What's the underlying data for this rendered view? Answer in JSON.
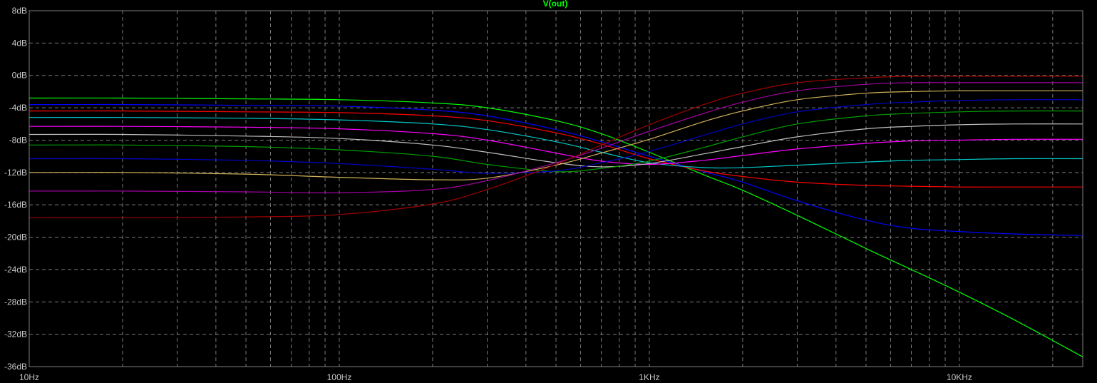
{
  "chart_data": {
    "type": "line",
    "title": "V(out)",
    "xscale": "log",
    "xlim": [
      10,
      25000
    ],
    "ylim": [
      -36,
      8
    ],
    "grid": true,
    "x_ticks": [
      {
        "value": 10,
        "label": "10Hz"
      },
      {
        "value": 100,
        "label": "100Hz"
      },
      {
        "value": 1000,
        "label": "1KHz"
      },
      {
        "value": 10000,
        "label": "10KHz"
      }
    ],
    "y_ticks": [
      {
        "value": 8,
        "label": "8dB"
      },
      {
        "value": 4,
        "label": "4dB"
      },
      {
        "value": 0,
        "label": "0dB"
      },
      {
        "value": -4,
        "label": "-4dB"
      },
      {
        "value": -8,
        "label": "-8dB"
      },
      {
        "value": -12,
        "label": "-12dB"
      },
      {
        "value": -16,
        "label": "-16dB"
      },
      {
        "value": -20,
        "label": "-20dB"
      },
      {
        "value": -24,
        "label": "-24dB"
      },
      {
        "value": -28,
        "label": "-28dB"
      },
      {
        "value": -32,
        "label": "-32dB"
      },
      {
        "value": -36,
        "label": "-36dB"
      }
    ],
    "x": [
      10,
      20,
      50,
      100,
      200,
      300,
      500,
      700,
      1000,
      1500,
      2000,
      3000,
      5000,
      7000,
      10000,
      15000,
      25000
    ],
    "series": [
      {
        "color": "#00ff00",
        "values": [
          -2.8,
          -2.8,
          -2.9,
          -3.0,
          -3.4,
          -4.0,
          -5.6,
          -7.2,
          -9.5,
          -12.3,
          -14.2,
          -17.3,
          -21.4,
          -24.0,
          -26.8,
          -30.2,
          -34.8
        ]
      },
      {
        "color": "#0000ff",
        "values": [
          -3.6,
          -3.6,
          -3.7,
          -3.8,
          -4.3,
          -5.0,
          -6.7,
          -8.2,
          -10.0,
          -11.9,
          -13.2,
          -15.5,
          -17.9,
          -18.9,
          -19.3,
          -19.6,
          -19.8
        ]
      },
      {
        "color": "#ff0000",
        "values": [
          -4.4,
          -4.4,
          -4.5,
          -4.6,
          -5.0,
          -5.6,
          -7.1,
          -8.5,
          -10.3,
          -11.8,
          -12.5,
          -13.2,
          -13.6,
          -13.7,
          -13.8,
          -13.8,
          -13.8
        ]
      },
      {
        "color": "#00c8c8",
        "values": [
          -5.2,
          -5.2,
          -5.3,
          -5.5,
          -6.0,
          -6.7,
          -8.2,
          -9.5,
          -10.8,
          -11.4,
          -11.4,
          -11.1,
          -10.7,
          -10.5,
          -10.4,
          -10.3,
          -10.3
        ]
      },
      {
        "color": "#ff00ff",
        "values": [
          -6.3,
          -6.3,
          -6.4,
          -6.6,
          -7.2,
          -8.0,
          -9.6,
          -10.6,
          -11.0,
          -10.5,
          -9.9,
          -9.1,
          -8.4,
          -8.1,
          -8.0,
          -7.9,
          -7.9
        ]
      },
      {
        "color": "#c0c0c0",
        "values": [
          -7.3,
          -7.3,
          -7.5,
          -7.8,
          -8.6,
          -9.5,
          -10.8,
          -11.3,
          -10.9,
          -9.7,
          -8.8,
          -7.6,
          -6.6,
          -6.3,
          -6.1,
          -6.0,
          -6.0
        ]
      },
      {
        "color": "#00a000",
        "values": [
          -8.6,
          -8.6,
          -8.8,
          -9.2,
          -10.0,
          -11.0,
          -11.9,
          -11.5,
          -10.6,
          -8.9,
          -7.6,
          -6.0,
          -5.0,
          -4.7,
          -4.5,
          -4.4,
          -4.4
        ]
      },
      {
        "color": "#0000c8",
        "values": [
          -10.3,
          -10.3,
          -10.5,
          -10.9,
          -11.6,
          -12.1,
          -11.8,
          -10.8,
          -9.4,
          -7.4,
          -6.0,
          -4.5,
          -3.6,
          -3.3,
          -3.1,
          -3.0,
          -3.0
        ]
      },
      {
        "color": "#d2b45a",
        "values": [
          -12.0,
          -12.0,
          -12.2,
          -12.6,
          -12.9,
          -12.7,
          -11.1,
          -9.6,
          -7.9,
          -5.7,
          -4.4,
          -3.0,
          -2.2,
          -2.0,
          -1.9,
          -1.9,
          -1.9
        ]
      },
      {
        "color": "#a000a0",
        "values": [
          -14.3,
          -14.3,
          -14.4,
          -14.5,
          -14.1,
          -13.0,
          -10.8,
          -9.0,
          -6.9,
          -4.7,
          -3.3,
          -1.9,
          -1.1,
          -0.9,
          -0.9,
          -0.9,
          -0.9
        ]
      },
      {
        "color": "#a00000",
        "values": [
          -17.6,
          -17.6,
          -17.5,
          -17.2,
          -15.9,
          -14.1,
          -11.0,
          -8.6,
          -6.1,
          -3.6,
          -2.2,
          -0.9,
          -0.3,
          -0.1,
          -0.1,
          -0.1,
          -0.1
        ]
      }
    ]
  }
}
